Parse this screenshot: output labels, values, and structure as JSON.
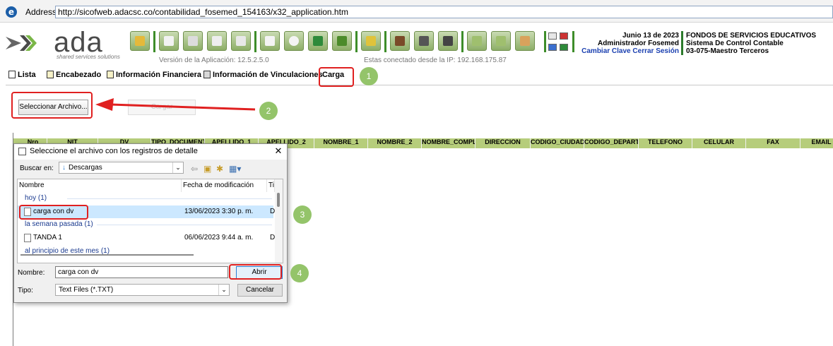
{
  "address_bar": {
    "label": "Address:",
    "url": "http://sicofweb.adacsc.co/contabilidad_fosemed_154163/x32_application.htm"
  },
  "app": {
    "logo_text": "ada",
    "logo_sub": "shared services solutions",
    "version_text": "Versión de la Aplicación: 12.5.2.5.0",
    "ip_text": "Estas conectado desde la IP: 192.168.175.87",
    "date": "Junio 13 de 2023",
    "user": "Administrador Fosemed",
    "link_change_password": "Cambiar Clave",
    "link_logout": "Cerrar Sesión",
    "entity": "FONDOS DE SERVICIOS EDUCATIVOS",
    "system": "Sistema De Control Contable",
    "module": "03-075-Maestro Terceros"
  },
  "toolbar_icons": [
    "folder-icon",
    "add-icon",
    "save-icon",
    "delete-icon",
    "undo-icon",
    "print-icon",
    "search-icon",
    "excel-icon",
    "basket-icon",
    "lock-icon",
    "money-icon",
    "camera-icon",
    "grid-icon",
    "cart-icon",
    "home-icon",
    "people-icon"
  ],
  "tabs": [
    "Lista",
    "Encabezado",
    "Información Financiera",
    "Información de Vinculaciones",
    "Carga"
  ],
  "buttons": {
    "select_file": "Seleccionar Archivo...",
    "load": "Cargar"
  },
  "grid_columns": [
    "Nro",
    "NIT",
    "DV",
    "TIPO_DOCUMENTO",
    "APELLIDO_1",
    "APELLIDO_2",
    "NOMBRE_1",
    "NOMBRE_2",
    "NOMBRE_COMPLETO",
    "DIRECCION",
    "CODIGO_CIUDAD",
    "CODIGO_DEPARTAMENTO",
    "TELEFONO",
    "CELULAR",
    "FAX",
    "EMAIL"
  ],
  "steps": [
    "1",
    "2",
    "3",
    "4"
  ],
  "dialog": {
    "title": "Seleccione el archivo con los registros de detalle",
    "close": "✕",
    "look_in_label": "Buscar en:",
    "look_in_value": "Descargas",
    "columns": [
      "Nombre",
      "Fecha de modificación",
      "Ti"
    ],
    "groups": [
      {
        "label": "hoy (1)"
      },
      {
        "label": "la semana pasada (1)"
      },
      {
        "label": "al principio de este mes (1)"
      }
    ],
    "files": [
      {
        "name": "carga con dv",
        "date": "13/06/2023 3:30 p. m.",
        "type": "D"
      },
      {
        "name": "TANDA 1",
        "date": "06/06/2023 9:44 a. m.",
        "type": "D"
      }
    ],
    "name_label": "Nombre:",
    "name_value": "carga con dv",
    "type_label": "Tipo:",
    "type_value": "Text Files (*.TXT)",
    "open_button": "Abrir",
    "cancel_button": "Cancelar"
  },
  "colors": {
    "accent_green": "#94c46a",
    "grid_header": "#b6cd7b",
    "callout_red": "#e02020"
  }
}
